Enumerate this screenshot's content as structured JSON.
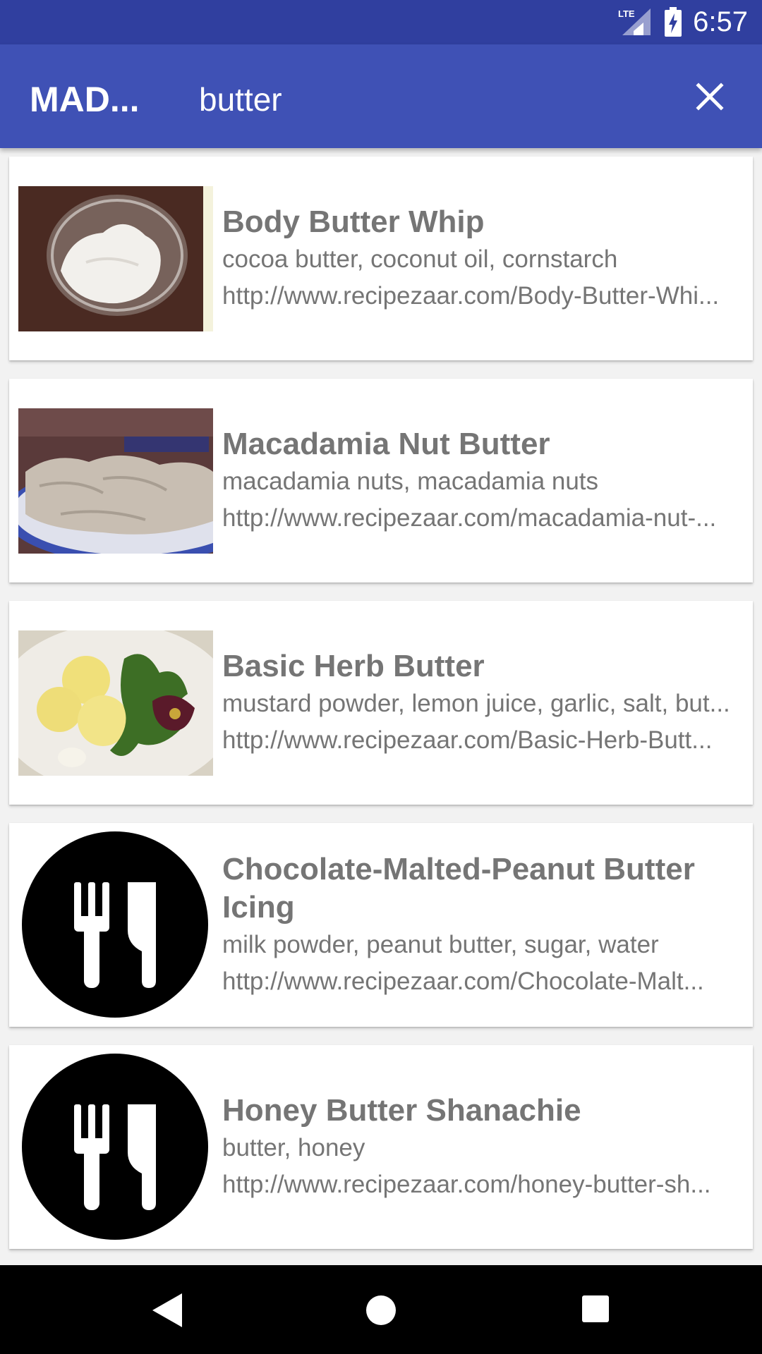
{
  "status_bar": {
    "time": "6:57",
    "network_label": "LTE"
  },
  "app_bar": {
    "title": "MAD...",
    "search_value": "butter",
    "search_placeholder": ""
  },
  "results": [
    {
      "title": "Body Butter Whip",
      "ingredients": "cocoa butter, coconut oil, cornstarch",
      "url": "http://www.recipezaar.com/Body-Butter-Whi...",
      "image": "photo"
    },
    {
      "title": "Macadamia Nut Butter",
      "ingredients": "macadamia nuts, macadamia nuts",
      "url": "http://www.recipezaar.com/macadamia-nut-...",
      "image": "photo"
    },
    {
      "title": "Basic Herb Butter",
      "ingredients": "mustard powder, lemon juice, garlic, salt, but...",
      "url": "http://www.recipezaar.com/Basic-Herb-Butt...",
      "image": "photo"
    },
    {
      "title": "Chocolate-Malted-Peanut Butter Icing",
      "ingredients": "milk powder, peanut butter, sugar, water",
      "url": "http://www.recipezaar.com/Chocolate-Malt...",
      "image": "utensils-icon"
    },
    {
      "title": "Honey Butter Shanachie",
      "ingredients": "butter, honey",
      "url": "http://www.recipezaar.com/honey-butter-sh...",
      "image": "utensils-icon"
    }
  ],
  "colors": {
    "status_bar": "#303f9f",
    "app_bar": "#3f51b5",
    "text_secondary": "#757575"
  }
}
